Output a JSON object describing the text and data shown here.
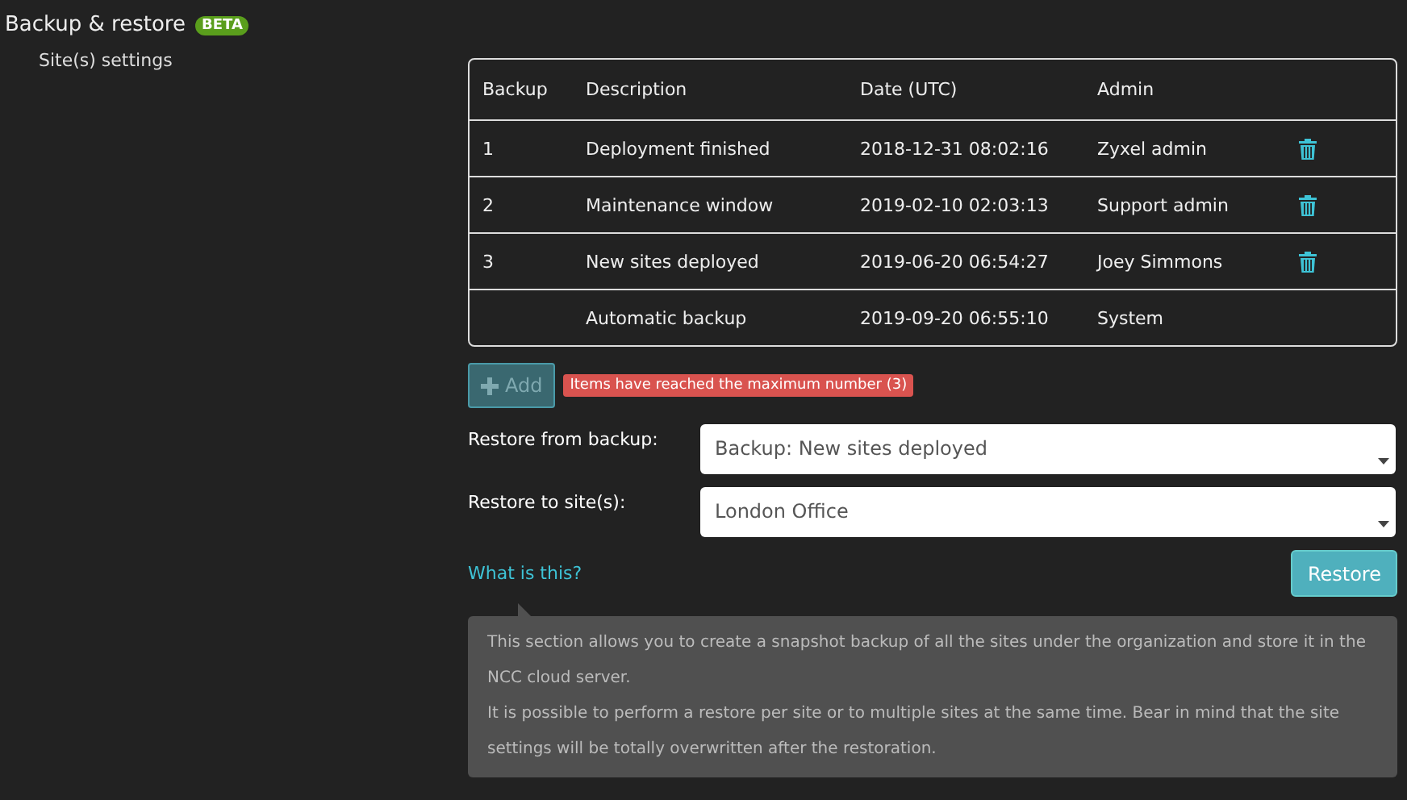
{
  "header": {
    "title": "Backup & restore",
    "badge": "BETA"
  },
  "sidebar": {
    "items": [
      {
        "label": "Site(s) settings"
      }
    ]
  },
  "table": {
    "columns": [
      "Backup",
      "Description",
      "Date (UTC)",
      "Admin"
    ],
    "rows": [
      {
        "backup": "1",
        "description": "Deployment finished",
        "date": "2018-12-31 08:02:16",
        "admin": "Zyxel admin",
        "deletable": true
      },
      {
        "backup": "2",
        "description": "Maintenance window",
        "date": "2019-02-10 02:03:13",
        "admin": "Support admin",
        "deletable": true
      },
      {
        "backup": "3",
        "description": "New sites deployed",
        "date": "2019-06-20 06:54:27",
        "admin": "Joey Simmons",
        "deletable": true
      },
      {
        "backup": "",
        "description": "Automatic backup",
        "date": "2019-09-20 06:55:10",
        "admin": "System",
        "deletable": false
      }
    ]
  },
  "add_button": {
    "label": "Add",
    "disabled": true
  },
  "limit_warning": "Items have reached the maximum number (3)",
  "form": [
    {
      "label": "Restore from backup:",
      "value": "Backup: New sites deployed"
    },
    {
      "label": "Restore to site(s):",
      "value": "London Office"
    }
  ],
  "help_link": "What is this?",
  "restore_button": "Restore",
  "info": [
    "This section allows you to create a snapshot backup of all the sites under the organization and store it in the NCC cloud server.",
    "It is possible to perform a restore per site or to multiple sites at the same time. Bear in mind that the site settings will be totally overwritten after the restoration."
  ]
}
